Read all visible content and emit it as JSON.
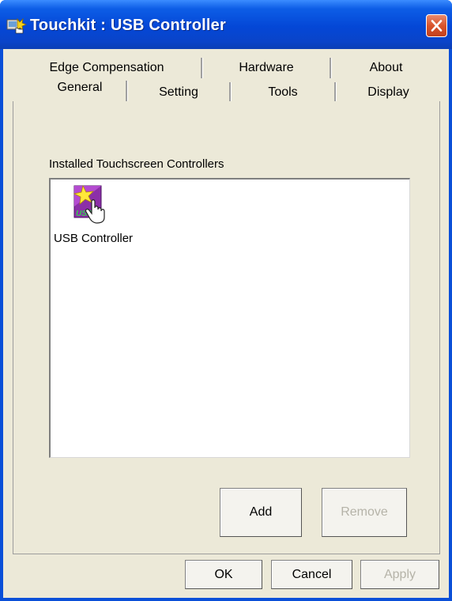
{
  "window": {
    "title": "Touchkit : USB Controller",
    "title_bar_color": "#0447d6"
  },
  "tabs": {
    "row1": [
      {
        "label": "Edge Compensation"
      },
      {
        "label": "Hardware"
      },
      {
        "label": "About"
      }
    ],
    "row2": [
      {
        "label": "General",
        "active": true
      },
      {
        "label": "Setting"
      },
      {
        "label": "Tools"
      },
      {
        "label": "Display"
      }
    ]
  },
  "general": {
    "list_label": "Installed Touchscreen Controllers",
    "controllers": [
      {
        "name": "USB Controller",
        "icon": "usb-controller-icon"
      }
    ],
    "add_label": "Add",
    "remove_label": "Remove"
  },
  "footer": {
    "ok_label": "OK",
    "cancel_label": "Cancel",
    "apply_label": "Apply"
  }
}
